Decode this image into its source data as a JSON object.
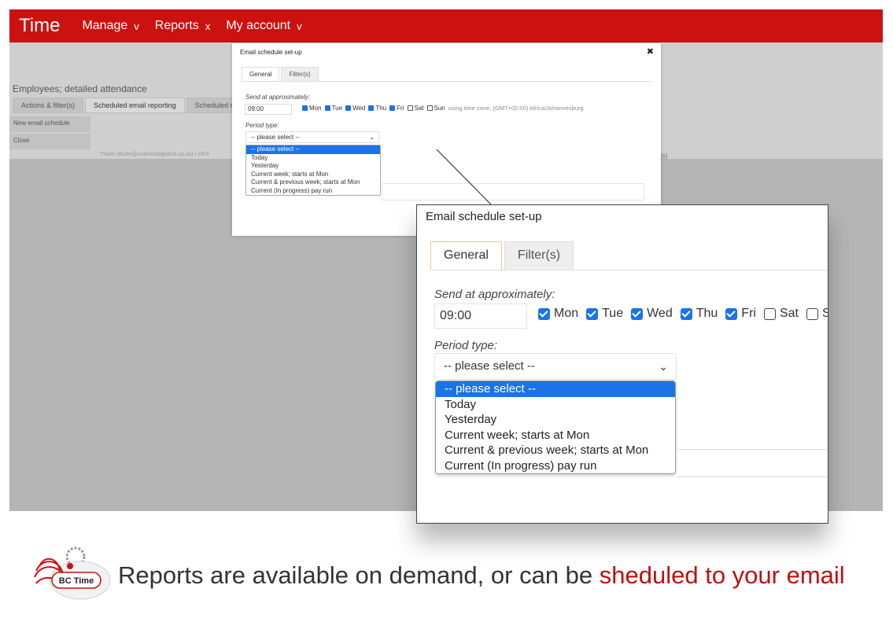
{
  "app": {
    "brand": "Time",
    "nav": [
      {
        "label": "Manage",
        "caret": "v"
      },
      {
        "label": "Reports",
        "caret": "x"
      },
      {
        "label": "My account",
        "caret": "v"
      }
    ]
  },
  "page": {
    "title": "Employees; detailed attendance",
    "tabs": [
      "Actions & filter(s)",
      "Scheduled email reporting",
      "Scheduled real-ti"
    ],
    "buttons": {
      "new_schedule": "New email schedule",
      "close": "Close"
    },
    "row_text": "Thulie (thulie@umbonologistics.co.za) • 09:0",
    "row_text_right": "er(s)"
  },
  "dialog": {
    "title": "Email schedule set-up",
    "close_glyph": "✖",
    "tabs": [
      "General",
      "Filter(s)"
    ],
    "send_label": "Send at approximately:",
    "time_value": "09:00",
    "days": [
      {
        "label": "Mon",
        "checked": true
      },
      {
        "label": "Tue",
        "checked": true
      },
      {
        "label": "Wed",
        "checked": true
      },
      {
        "label": "Thu",
        "checked": true
      },
      {
        "label": "Fri",
        "checked": true
      },
      {
        "label": "Sat",
        "checked": false
      },
      {
        "label": "Sun",
        "checked": false
      }
    ],
    "timezone_note": "using time zone, (GMT+02:00) Africa/Johannesburg",
    "period_label": "Period type:",
    "period_selected": "-- please select --",
    "period_options": [
      "-- please select --",
      "Today",
      "Yesterday",
      "Current week; starts at Mon",
      "Current & previous week; starts at Mon",
      "Current (In progress) pay run"
    ]
  },
  "footer": {
    "text": "Reports are available on demand, or can be ",
    "highlight": "sheduled to your email",
    "logo_text": "BC Time",
    "highlight_color": "#bb1111"
  },
  "colors": {
    "brand_red": "#cc1111",
    "checkbox_blue": "#1a73e8"
  }
}
